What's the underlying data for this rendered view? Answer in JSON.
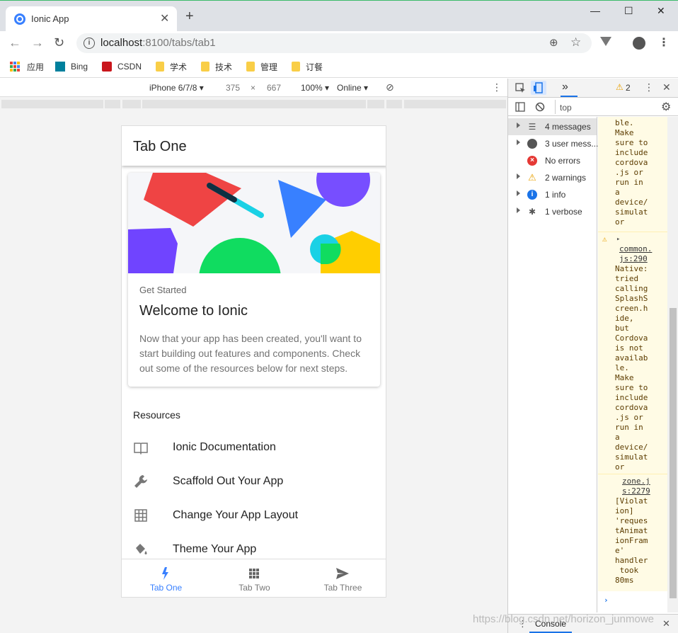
{
  "browser": {
    "tab_title": "Ionic App",
    "tab_close": "✕",
    "new_tab": "+",
    "url_host": "localhost",
    "url_rest": ":8100/tabs/tab1",
    "window_controls": {
      "minimize": "—",
      "maximize": "☐",
      "close": "✕"
    }
  },
  "bookmarks": [
    {
      "label": "应用",
      "icon": "apps-grid-icon"
    },
    {
      "label": "Bing",
      "icon": "bing-icon"
    },
    {
      "label": "CSDN",
      "icon": "csdn-icon"
    },
    {
      "label": "学术",
      "icon": "folder-icon"
    },
    {
      "label": "技术",
      "icon": "folder-icon"
    },
    {
      "label": "管理",
      "icon": "folder-icon"
    },
    {
      "label": "订餐",
      "icon": "folder-icon"
    }
  ],
  "device_toolbar": {
    "device": "iPhone 6/7/8 ▾",
    "width": "375",
    "times": "×",
    "height": "667",
    "zoom": "100% ▾",
    "network": "Online ▾"
  },
  "app": {
    "header_title": "Tab One",
    "card": {
      "subtitle": "Get Started",
      "title": "Welcome to Ionic",
      "body": "Now that your app has been created, you'll want to start building out features and components. Check out some of the resources below for next steps."
    },
    "resources_header": "Resources",
    "resources": [
      {
        "label": "Ionic Documentation",
        "icon": "book-icon"
      },
      {
        "label": "Scaffold Out Your App",
        "icon": "wrench-icon"
      },
      {
        "label": "Change Your App Layout",
        "icon": "grid-icon"
      },
      {
        "label": "Theme Your App",
        "icon": "paint-bucket-icon"
      }
    ],
    "tabs": [
      {
        "label": "Tab One",
        "icon": "flash-icon",
        "active": true
      },
      {
        "label": "Tab Two",
        "icon": "apps-icon",
        "active": false
      },
      {
        "label": "Tab Three",
        "icon": "send-icon",
        "active": false
      }
    ],
    "colors": {
      "primary": "#3880ff"
    }
  },
  "devtools": {
    "more_tabs": "»",
    "warning_count": "2",
    "context": "top",
    "sidebar": [
      {
        "label": "4 messages",
        "icon": "list-icon",
        "selected": true
      },
      {
        "label": "3 user mess...",
        "icon": "user-icon",
        "selected": false
      },
      {
        "label": "No errors",
        "icon": "error-icon",
        "selected": false
      },
      {
        "label": "2 warnings",
        "icon": "warning-icon",
        "selected": false
      },
      {
        "label": "1 info",
        "icon": "info-icon",
        "selected": false
      },
      {
        "label": "1 verbose",
        "icon": "bug-icon",
        "selected": false
      }
    ],
    "log": {
      "entry1": "availa\nble.\nMake\nsure to\ninclude\ncordova\n.js or\nrun in\na\ndevice/\nsimulat\nor",
      "entry2_link": "common.\njs:290",
      "entry2": "Native:\ntried\ncalling\nSplashS\ncreen.h\nide,\nbut\nCordova\nis not\navailab\nle.\nMake\nsure to\ninclude\ncordova\n.js or\nrun in\na\ndevice/\nsimulat\nor",
      "entry3_link": "zone.j\ns:2279",
      "entry3": "[Violat\nion]\n'reques\ntAnimat\nionFram\ne'\nhandler\n took\n80ms"
    },
    "drawer_tab": "Console"
  },
  "watermark": "https://blog.csdn.net/horizon_junmowe"
}
